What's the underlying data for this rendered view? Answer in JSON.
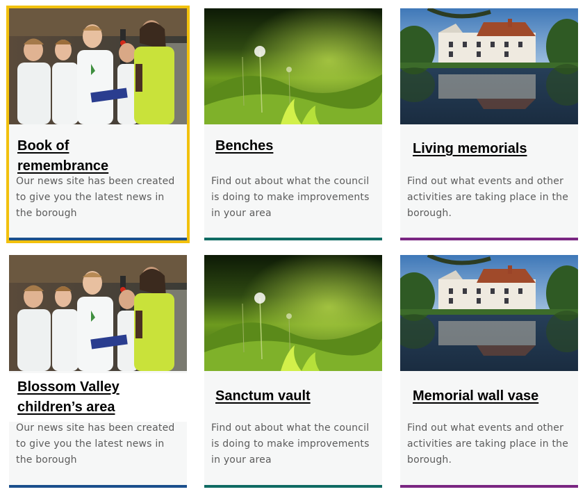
{
  "cards": [
    {
      "title": "Book of remembrance",
      "description": "Our news site has been created to give you the latest news in the borough",
      "image": "children-with-volunteer-photo",
      "accent": "#1b4f8c"
    },
    {
      "title": "Benches",
      "description": "Find out about what the council is doing to make improvements in your area",
      "image": "dandelion-grass-photo",
      "accent": "#0f6b63"
    },
    {
      "title": "Living memorials",
      "description": "Find out what events and other activities are taking place in the borough.",
      "image": "manor-house-lake-photo",
      "accent": "#7a2682"
    },
    {
      "title": "Blossom Valley children’s area",
      "description": "Our news site has been created to give you the latest news in the borough",
      "image": "children-with-volunteer-photo",
      "accent": "#1b4f8c"
    },
    {
      "title": "Sanctum vault",
      "description": "Find out about what the council is doing to make improvements in your area",
      "image": "dandelion-grass-photo",
      "accent": "#0f6b63"
    },
    {
      "title": "Memorial wall vase",
      "description": "Find out what events and other activities are taking place in the borough.",
      "image": "manor-house-lake-photo",
      "accent": "#7a2682"
    }
  ],
  "selected_card": "Book of remembrance",
  "highlight_color": "#f2c10d"
}
